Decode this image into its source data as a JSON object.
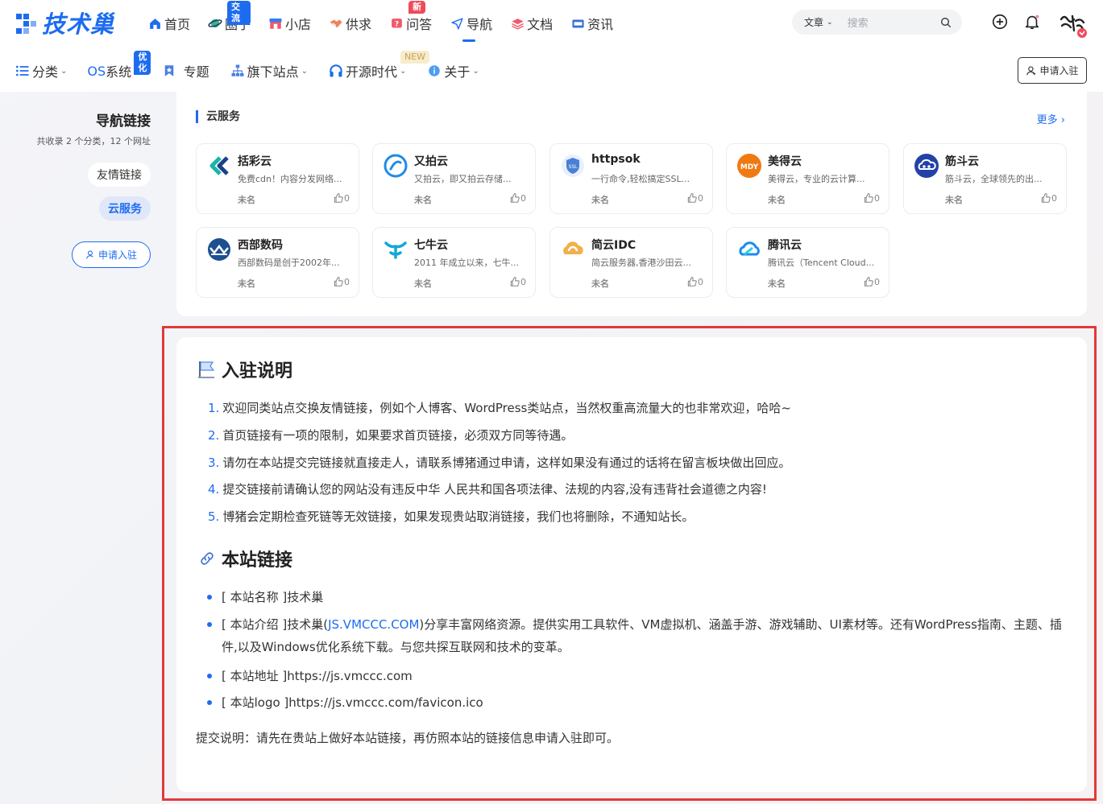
{
  "logo": {
    "text": "技术巢"
  },
  "nav_primary": [
    {
      "label": "首页",
      "icon": "home-icon"
    },
    {
      "label": "圈子",
      "icon": "planet-icon",
      "badge": "交流",
      "badge_color": "#1d6cf0"
    },
    {
      "label": "小店",
      "icon": "shop-icon"
    },
    {
      "label": "供求",
      "icon": "handshake-icon"
    },
    {
      "label": "问答",
      "icon": "question-icon",
      "badge": "新",
      "badge_color": "#f04a5a"
    },
    {
      "label": "导航",
      "icon": "navigation-icon",
      "active": true
    },
    {
      "label": "文档",
      "icon": "layers-icon"
    },
    {
      "label": "资讯",
      "icon": "news-icon"
    }
  ],
  "search": {
    "scope": "文章",
    "placeholder": "搜索"
  },
  "nav_secondary": [
    {
      "label": "分类",
      "icon": "list-icon",
      "dropdown": true
    },
    {
      "label": "系统",
      "prefix": "OS",
      "icon": "",
      "dropdown": true,
      "badge": "优化",
      "badge_color": "#1d6cf0"
    },
    {
      "label": "专题",
      "icon": "bookmark-icon",
      "dropdown": false
    },
    {
      "label": "旗下站点",
      "icon": "sitemap-icon",
      "dropdown": true
    },
    {
      "label": "开源时代",
      "icon": "headset-icon",
      "dropdown": true,
      "badge": "NEW",
      "badge_color": "#f5e9c8"
    },
    {
      "label": "关于",
      "icon": "info-icon",
      "dropdown": true
    }
  ],
  "apply_button": "申请入驻",
  "sidebar": {
    "title": "导航链接",
    "subtitle": "共收录 2 个分类，12 个网址",
    "links": [
      "友情链接",
      "云服务"
    ],
    "apply": "申请入驻"
  },
  "cloud": {
    "heading": "云服务",
    "more": "更多",
    "sites": [
      {
        "name": "括彩云",
        "desc": "免费cdn！内容分发网络...",
        "tag": "未名",
        "likes": "0",
        "icon": "kuocai-logo-icon",
        "color": "#16b6a6"
      },
      {
        "name": "又拍云",
        "desc": "又拍云，即又拍云存储...",
        "tag": "未名",
        "likes": "0",
        "icon": "upyun-logo-icon",
        "color": "#1f8ce6"
      },
      {
        "name": "httpsok",
        "desc": "一行命令,轻松搞定SSL...",
        "tag": "未名",
        "likes": "0",
        "icon": "ssl-shield-icon",
        "color": "#4a7fd6"
      },
      {
        "name": "美得云",
        "desc": "美得云，专业的云计算...",
        "tag": "未名",
        "likes": "0",
        "icon": "meideyun-logo-icon",
        "color": "#f07a12"
      },
      {
        "name": "筋斗云",
        "desc": "筋斗云，全球领先的出...",
        "tag": "未名",
        "likes": "0",
        "icon": "jindouyun-logo-icon",
        "color": "#2342a8"
      },
      {
        "name": "西部数码",
        "desc": "西部数码是创于2002年...",
        "tag": "未名",
        "likes": "0",
        "icon": "west-cn-logo-icon",
        "color": "#1d4f91"
      },
      {
        "name": "七牛云",
        "desc": "2011 年成立以来，七牛...",
        "tag": "未名",
        "likes": "0",
        "icon": "qiniu-logo-icon",
        "color": "#15a7d8"
      },
      {
        "name": "简云IDC",
        "desc": "简云服务器,香港沙田云...",
        "tag": "未名",
        "likes": "0",
        "icon": "jianyun-logo-icon",
        "color": "#f0a12a"
      },
      {
        "name": "腾讯云",
        "desc": "腾讯云（Tencent Cloud...",
        "tag": "未名",
        "likes": "0",
        "icon": "tencent-cloud-logo-icon",
        "color": "#1a8bf0"
      }
    ]
  },
  "info": {
    "rules_title": "入驻说明",
    "rules": [
      "欢迎同类站点交换友情链接，例如个人博客、WordPress类站点，当然权重高流量大的也非常欢迎，哈哈~",
      "首页链接有一项的限制，如果要求首页链接，必须双方同等待遇。",
      "请勿在本站提交完链接就直接走人，请联系博猪通过申请，这样如果没有通过的话将在留言板块做出回应。",
      "提交链接前请确认您的网站没有违反中华 人民共和国各项法律、法规的内容,没有违背社会道德之内容!",
      "博猪会定期检查死链等无效链接，如果发现贵站取消链接，我们也将删除，不通知站长。"
    ],
    "site_title": "本站链接",
    "site_name": "[ 本站名称 ]技术巢",
    "site_intro_pre": "[ 本站介绍 ]技术巢(",
    "site_intro_link": "JS.VMCCC.COM",
    "site_intro_post": ")分享丰富网络资源。提供实用工具软件、VM虚拟机、涵盖手游、游戏辅助、UI素材等。还有WordPress指南、主题、插件,以及Windows优化系统下载。与您共探互联网和技术的变革。",
    "site_url": "[ 本站地址 ]https://js.vmccc.com",
    "site_logo": "[ 本站logo ]https://js.vmccc.com/favicon.ico",
    "submit_note": "提交说明：请先在贵站上做好本站链接，再仿照本站的链接信息申请入驻即可。"
  }
}
